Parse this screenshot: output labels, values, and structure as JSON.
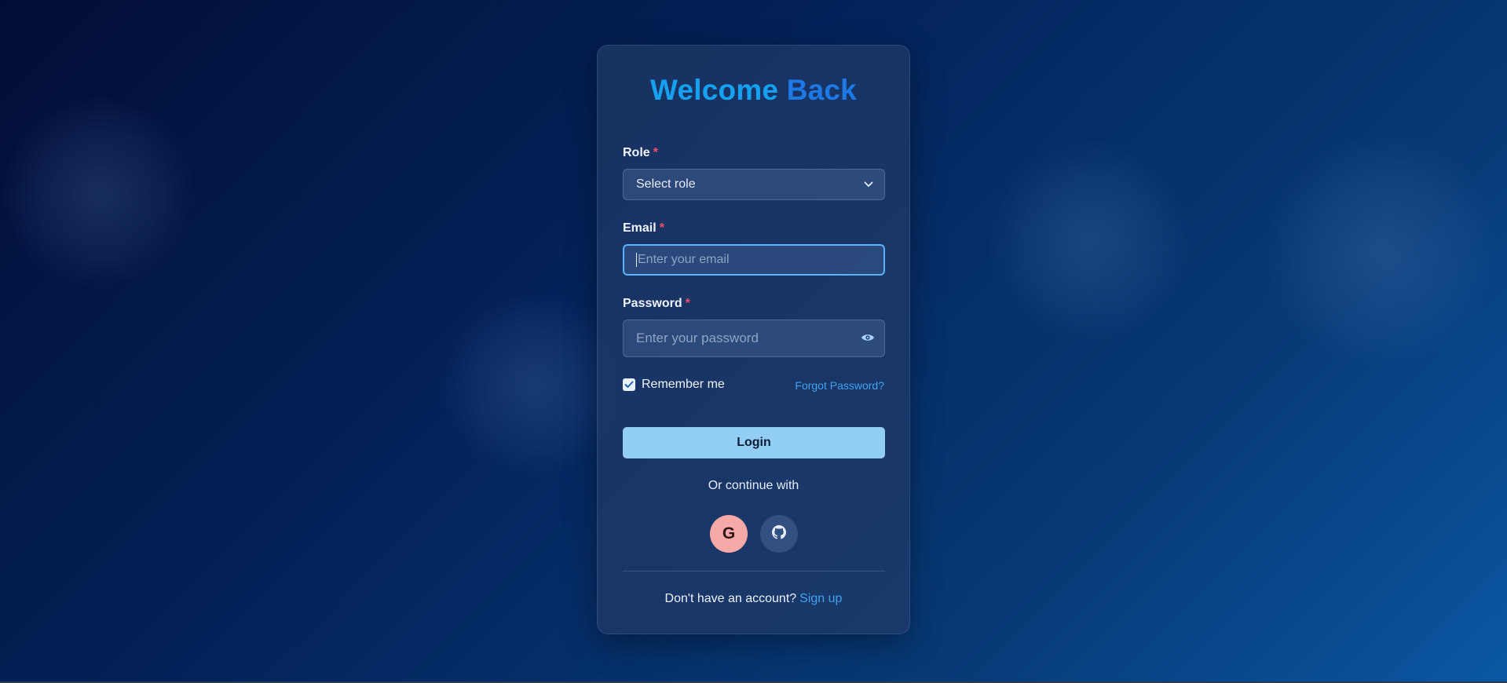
{
  "login": {
    "title_part1": "Welcome",
    "title_part2": "Back",
    "role": {
      "label": "Role",
      "required_mark": "*",
      "selected": "Select role",
      "icon": "chevron-down-icon"
    },
    "email": {
      "label": "Email",
      "required_mark": "*",
      "value": "",
      "placeholder": "Enter your email"
    },
    "password": {
      "label": "Password",
      "required_mark": "*",
      "value": "",
      "placeholder": "Enter your password",
      "icon": "eye-icon"
    },
    "remember": {
      "label": "Remember me",
      "checked": true
    },
    "forgot_link": "Forgot Password?",
    "login_button": "Login",
    "or_text": "Or continue with",
    "social": {
      "google_label": "G",
      "google_icon": "google-icon",
      "github_icon": "github-icon"
    },
    "signup": {
      "prompt": "Don't have an account?",
      "link": "Sign up"
    }
  },
  "colors": {
    "title_start": "#14a1ef",
    "title_end": "#1d79e6",
    "required": "#f0506e",
    "link": "#3fa3f0",
    "login_button_bg": "#91cdf5",
    "google_bg": "#f7a9a7",
    "focus_border": "#58b4ff"
  }
}
